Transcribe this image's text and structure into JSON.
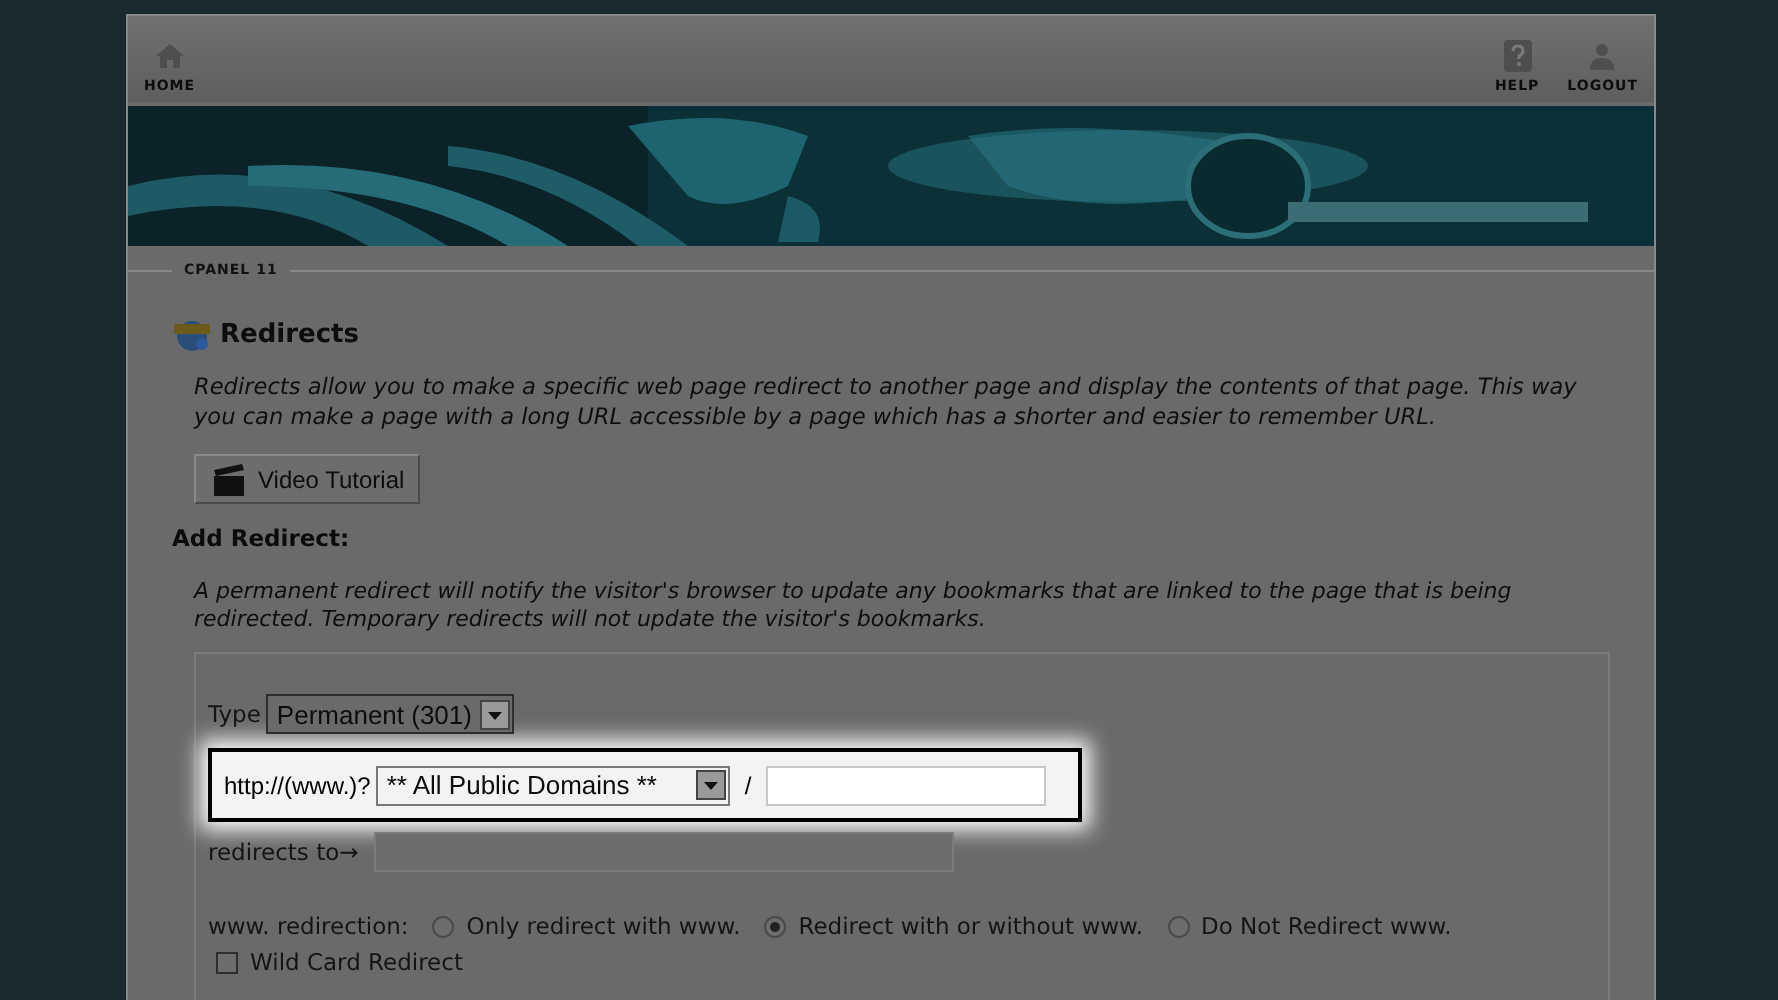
{
  "top_nav": [
    {
      "kind": "home",
      "label": "HOME"
    },
    {
      "kind": "help",
      "label": "HELP"
    },
    {
      "kind": "logout",
      "label": "LOGOUT"
    }
  ],
  "breadcrumb": "CPANEL 11",
  "page": {
    "title": "Redirects",
    "description": "Redirects allow you to make a specific web page redirect to another page and display the contents of that page. This way you can make a page with a long URL accessible by a page which has a shorter and easier to remember URL.",
    "video_button": "Video Tutorial"
  },
  "add_redirect": {
    "heading": "Add Redirect:",
    "note": "A permanent redirect will notify the visitor's browser to update any bookmarks that are linked to the page that is being redirected. Temporary redirects will not update the visitor's bookmarks."
  },
  "form": {
    "type_label": "Type",
    "type_select": "Permanent (301)",
    "domain_row": {
      "highlighted": true,
      "prefix": "http://(www.)?",
      "domain_select": "** All Public Domains **",
      "separator": "/"
    },
    "redirects_to_label": "redirects to→",
    "www_label": "www. redirection:",
    "www_options": [
      {
        "label": "Only redirect with www.",
        "selected": false
      },
      {
        "label": "Redirect with or without www.",
        "selected": true
      },
      {
        "label": "Do Not Redirect www.",
        "selected": false
      }
    ],
    "wildcard": {
      "label": "Wild Card Redirect",
      "checked": false
    }
  }
}
